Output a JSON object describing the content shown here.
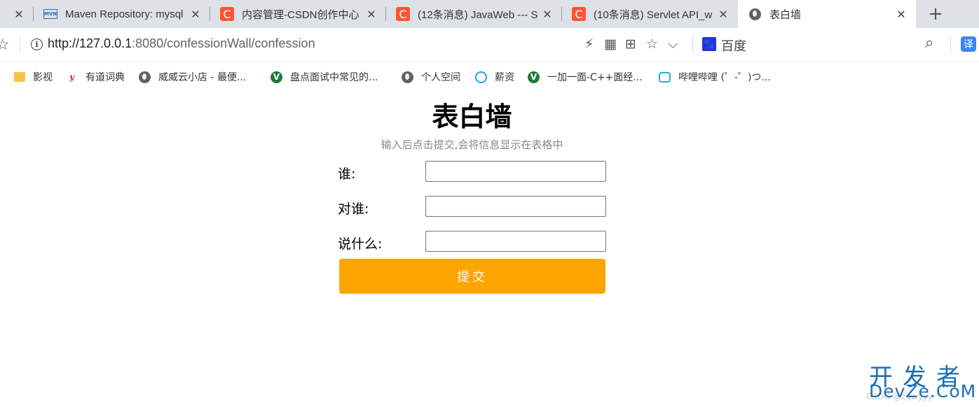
{
  "tabs": [
    {
      "title": "",
      "icon": "close-icon"
    },
    {
      "title": "Maven Repository: mysql",
      "icon": "maven-icon",
      "icon_text": "MVN"
    },
    {
      "title": "内容管理-CSDN创作中心",
      "icon": "csdn-icon",
      "icon_text": "C"
    },
    {
      "title": "(12条消息) JavaWeb --- S",
      "icon": "csdn-icon",
      "icon_text": "C"
    },
    {
      "title": "(10条消息) Servlet API_w",
      "icon": "csdn-icon",
      "icon_text": "C"
    },
    {
      "title": "表白墙",
      "icon": "globe-icon",
      "active": true
    }
  ],
  "glyphs": {
    "close": "✕",
    "new_tab": "+",
    "star": "☆",
    "chevron": "⌵",
    "bolt": "⚡",
    "search": "⌕",
    "info": "i",
    "grid": "▦",
    "translate_small": "⊞"
  },
  "address_bar": {
    "host": "http://127.0.0.1",
    "path": ":8080/confessionWall/confession"
  },
  "toolbar": {
    "search_engine_label": "百度",
    "search_engine_icon_text": "🐾",
    "translate_label": "译"
  },
  "bookmarks": [
    {
      "label": "影视",
      "icon": "folder-icon"
    },
    {
      "label": "有道词典",
      "icon": "youdao-icon",
      "icon_text": "y"
    },
    {
      "label": "威威云小店 - 最便...",
      "icon": "globe-icon"
    },
    {
      "label": "盘点面试中常见的...",
      "icon": "v-shield-icon",
      "icon_text": "V"
    },
    {
      "label": "个人空间",
      "icon": "globe-icon"
    },
    {
      "label": "薪资",
      "icon": "xinzi-icon"
    },
    {
      "label": "一加一面-C++面经...",
      "icon": "v-shield-icon",
      "icon_text": "V"
    },
    {
      "label": "哔哩哔哩 (゜-゜)つ...",
      "icon": "bilibili-icon"
    }
  ],
  "page": {
    "title": "表白墙",
    "subtitle": "输入后点击提交,会将信息显示在表格中",
    "fields": [
      {
        "label": "谁:",
        "value": ""
      },
      {
        "label": "对谁:",
        "value": ""
      },
      {
        "label": "说什么:",
        "value": ""
      }
    ],
    "submit_label": "提交"
  },
  "watermark": {
    "top": "开发者",
    "bottom": "DevZe.CoM",
    "faint": "CSDN @zqwyyy"
  },
  "colors": {
    "accent": "#ffa500",
    "tab_strip": "#dee1e6",
    "csdn": "#fc5531",
    "watermark": "#1a6fb3"
  }
}
